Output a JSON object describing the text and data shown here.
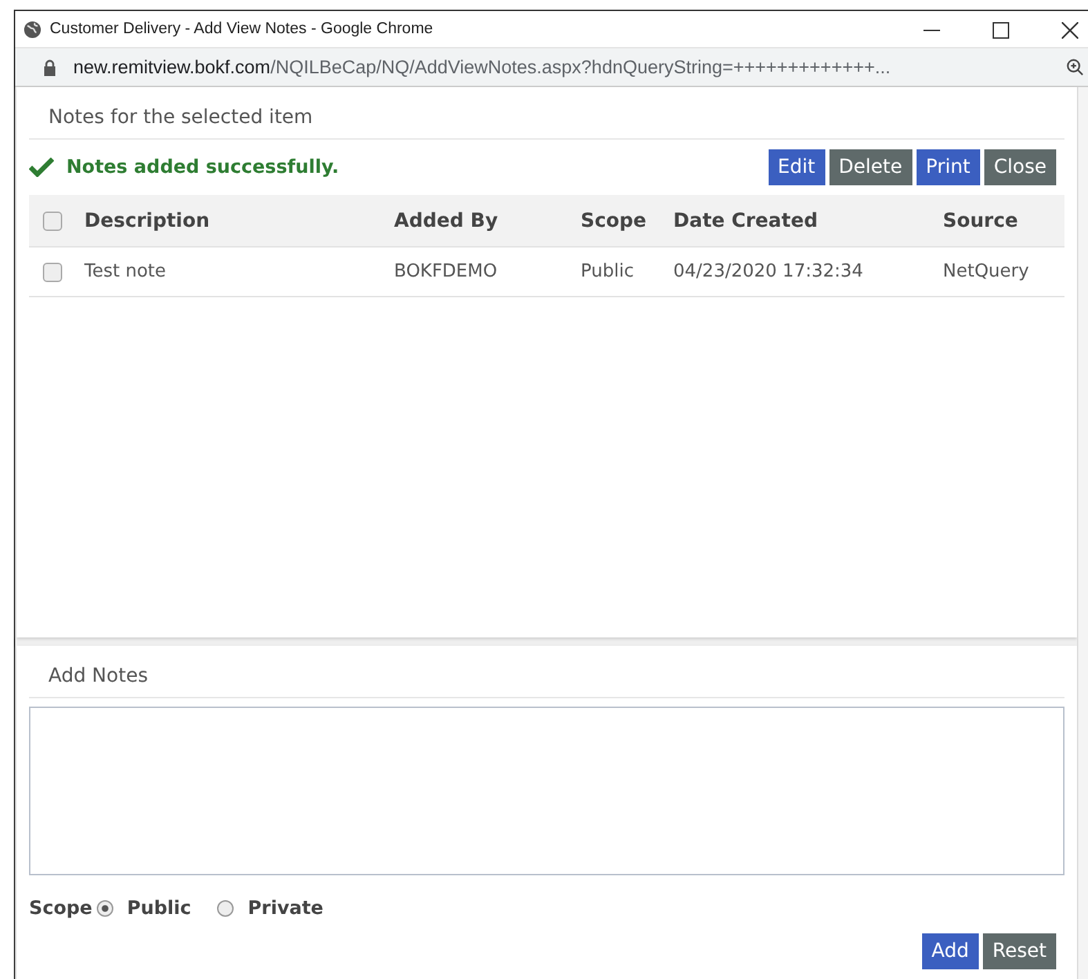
{
  "window": {
    "title": "Customer Delivery - Add View Notes - Google Chrome"
  },
  "address_bar": {
    "host": "new.remitview.bokf.com",
    "path": "/NQILBeCap/NQ/AddViewNotes.aspx?hdnQueryString=+++++++++++++..."
  },
  "notes_panel": {
    "title": "Notes for the selected item",
    "message": "Notes added successfully.",
    "buttons": [
      {
        "label": "Edit",
        "kind": "primary"
      },
      {
        "label": "Delete",
        "kind": "secondary"
      },
      {
        "label": "Print",
        "kind": "primary"
      },
      {
        "label": "Close",
        "kind": "secondary"
      }
    ],
    "table": {
      "select_all_checked": false,
      "columns": [
        "Description",
        "Added By",
        "Scope",
        "Date Created",
        "Source"
      ],
      "rows": [
        {
          "checked": false,
          "cells": [
            "Test note",
            "BOKFDEMO",
            "Public",
            "04/23/2020 17:32:34",
            "NetQuery"
          ]
        }
      ]
    }
  },
  "add_panel": {
    "title": "Add Notes",
    "scope_label": "Scope",
    "scope_options": [
      {
        "label": "Public",
        "selected": true
      },
      {
        "label": "Private",
        "selected": false
      }
    ],
    "buttons": [
      {
        "label": "Add",
        "kind": "primary"
      },
      {
        "label": "Reset",
        "kind": "secondary"
      }
    ]
  }
}
